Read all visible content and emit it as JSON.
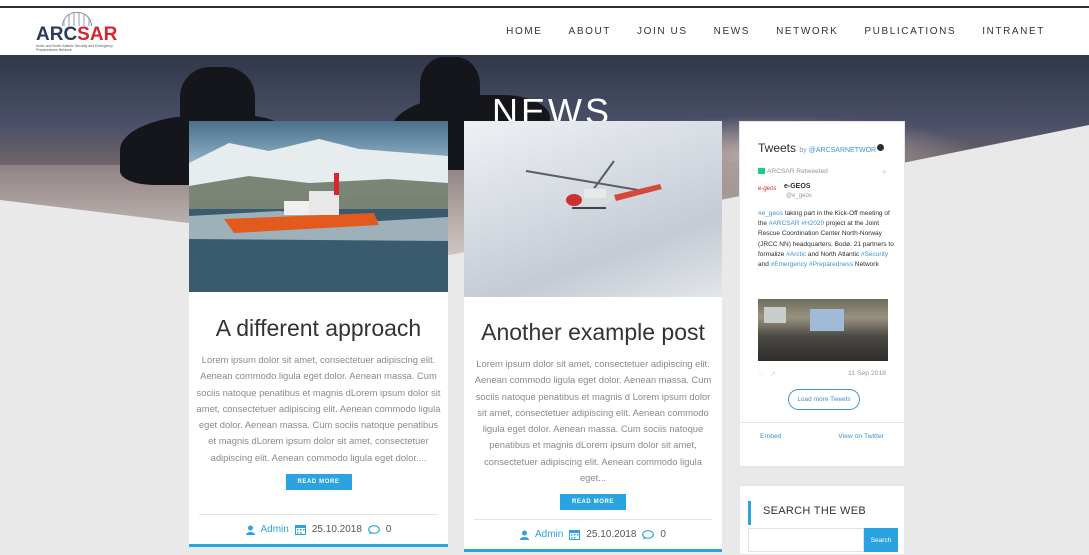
{
  "header": {
    "logo_word_prefix": "ARC",
    "logo_word_suffix": "SAR",
    "logo_tagline": "Arctic and North-Atlantic Security and Emergency Preparedness Network",
    "nav": [
      "HOME",
      "ABOUT",
      "JOIN US",
      "NEWS",
      "NETWORK",
      "PUBLICATIONS",
      "INTRANET"
    ]
  },
  "hero": {
    "title": "NEWS"
  },
  "posts": [
    {
      "title": "A different approach",
      "excerpt": "Lorem ipsum dolor sit amet, consectetuer adipiscing elit. Aenean commodo ligula eget dolor. Aenean massa. Cum sociis natoque penatibus et magnis dLorem ipsum dolor sit amet, consectetuer adipiscing elit. Aenean commodo ligula eget dolor. Aenean massa. Cum sociis natoque penatibus et magnis dLorem ipsum dolor sit amet, consectetuer adipiscing elit. Aenean commodo ligula eget dolor....",
      "button": "READ MORE",
      "author": "Admin",
      "date": "25.10.2018",
      "comments": "0"
    },
    {
      "title": "Another example post",
      "excerpt": "Lorem ipsum dolor sit amet, consectetuer adipiscing elit. Aenean commodo ligula eget dolor. Aenean massa. Cum sociis natoque penatibus et magnis d Lorem ipsum dolor sit amet, consectetuer adipiscing elit. Aenean commodo ligula eget dolor. Aenean massa. Cum sociis natoque penatibus et magnis dLorem ipsum dolor sit amet, consectetuer adipiscing elit. Aenean commodo ligula eget...",
      "button": "READ MORE",
      "author": "Admin",
      "date": "25.10.2018",
      "comments": "0"
    }
  ],
  "tweets": {
    "title": "Tweets",
    "by": "by",
    "account": "@ARCSARNETWOR",
    "retweeted": "ARCSAR Retweeted",
    "avatar_text": "e-geos",
    "name": "e-GEOS",
    "handle": "@e_geos",
    "text_parts": [
      {
        "t": "#e_geos",
        "h": true
      },
      {
        "t": " taking part in the Kick-Off meeting of the ",
        "h": false
      },
      {
        "t": "#ARCSAR",
        "h": true
      },
      {
        "t": " ",
        "h": false
      },
      {
        "t": "#H2020",
        "h": true
      },
      {
        "t": " project at the Joint Rescue Coordination Center North-Norway (JRCC NN) headquarters, Bodø. 21 partners to formalize ",
        "h": false
      },
      {
        "t": "#Arctic",
        "h": true
      },
      {
        "t": " and North Atlantic ",
        "h": false
      },
      {
        "t": "#Security",
        "h": true
      },
      {
        "t": " and ",
        "h": false
      },
      {
        "t": "#Emergency",
        "h": true
      },
      {
        "t": " ",
        "h": false
      },
      {
        "t": "#Preparedness",
        "h": true
      },
      {
        "t": " Network",
        "h": false
      }
    ],
    "date": "11 Sep 2018",
    "load_more": "Load more Tweets",
    "embed": "Embed",
    "view_on": "View on Twitter"
  },
  "search": {
    "title": "SEARCH THE WEB",
    "button": "Search",
    "placeholder": ""
  },
  "colors": {
    "accent": "#2aa3e0",
    "brand_red": "#d9232d",
    "brand_navy": "#2b3a5c"
  }
}
